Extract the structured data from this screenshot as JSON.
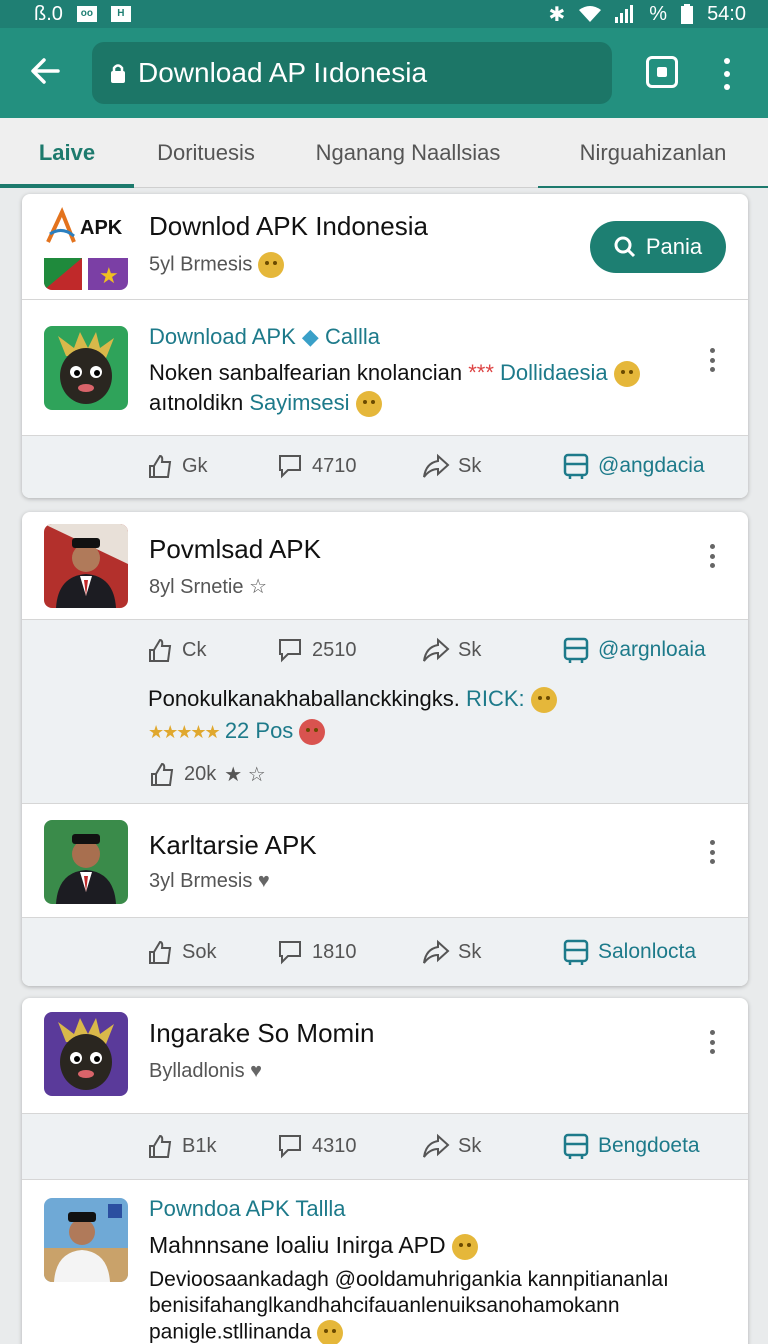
{
  "statusbar": {
    "left_text": "ß.0",
    "box1": "oo",
    "box2": "H",
    "pct": "%",
    "time": "54:0"
  },
  "appbar": {
    "url": "Download AP Iıdonesia"
  },
  "tabs": [
    {
      "label": "Laive"
    },
    {
      "label": "Dorituesis"
    },
    {
      "label": "Nganang Naallsias"
    },
    {
      "label": "Nirguahizanlan"
    }
  ],
  "header_card": {
    "logo_text": "APK",
    "title": "Downlod APK Indonesia",
    "subtitle": "5yl Brmesis",
    "search_label": "Pania"
  },
  "post1": {
    "title": "Download APK",
    "title_suffix": "Callla",
    "line1": "Noken sanbalfearian knolancian",
    "line1_link": "Dollidaesia",
    "line2": "aıtnoldikn",
    "line2_link": "Sayimsesi",
    "actions": {
      "like": "Gk",
      "comments": "4710",
      "share": "Sk",
      "source": "@angdacia"
    }
  },
  "post2": {
    "title": "Povmlsad APK",
    "subtitle": "8yl Srnetie",
    "actions": {
      "like": "Ck",
      "comments": "2510",
      "share": "Sk",
      "source": "@argnloaia"
    },
    "body": "Ponokulkanakhaballanckkingks.",
    "body_link": "RICK:",
    "rating_text": "22 Pos",
    "rating_value": 4.5,
    "likes": "20k"
  },
  "post3": {
    "title": "Karltarsie APK",
    "subtitle": "3yl Brmesis",
    "actions": {
      "like": "Sok",
      "comments": "1810",
      "share": "Sk",
      "source": "Salonlocta"
    }
  },
  "post4": {
    "title": "Ingarake So Momin",
    "subtitle": "Bylladlonis",
    "actions": {
      "like": "B1k",
      "comments": "4310",
      "share": "Sk",
      "source": "Bengdoeta"
    }
  },
  "post5": {
    "title": "Powndoa APK Tallla",
    "line1": "Mahnnsane loaliu Inirga APD",
    "line2": "Devioosaankadagh @ooldamuhrigankia kannpitiananlaı",
    "line3": "benisifahanglkandhahcifauanlenuiksanohamokann",
    "line4": "panigle.stllinanda"
  },
  "colors": {
    "primary": "#23907f",
    "statusbar": "#1f7f73",
    "link": "#1d7a8a"
  }
}
